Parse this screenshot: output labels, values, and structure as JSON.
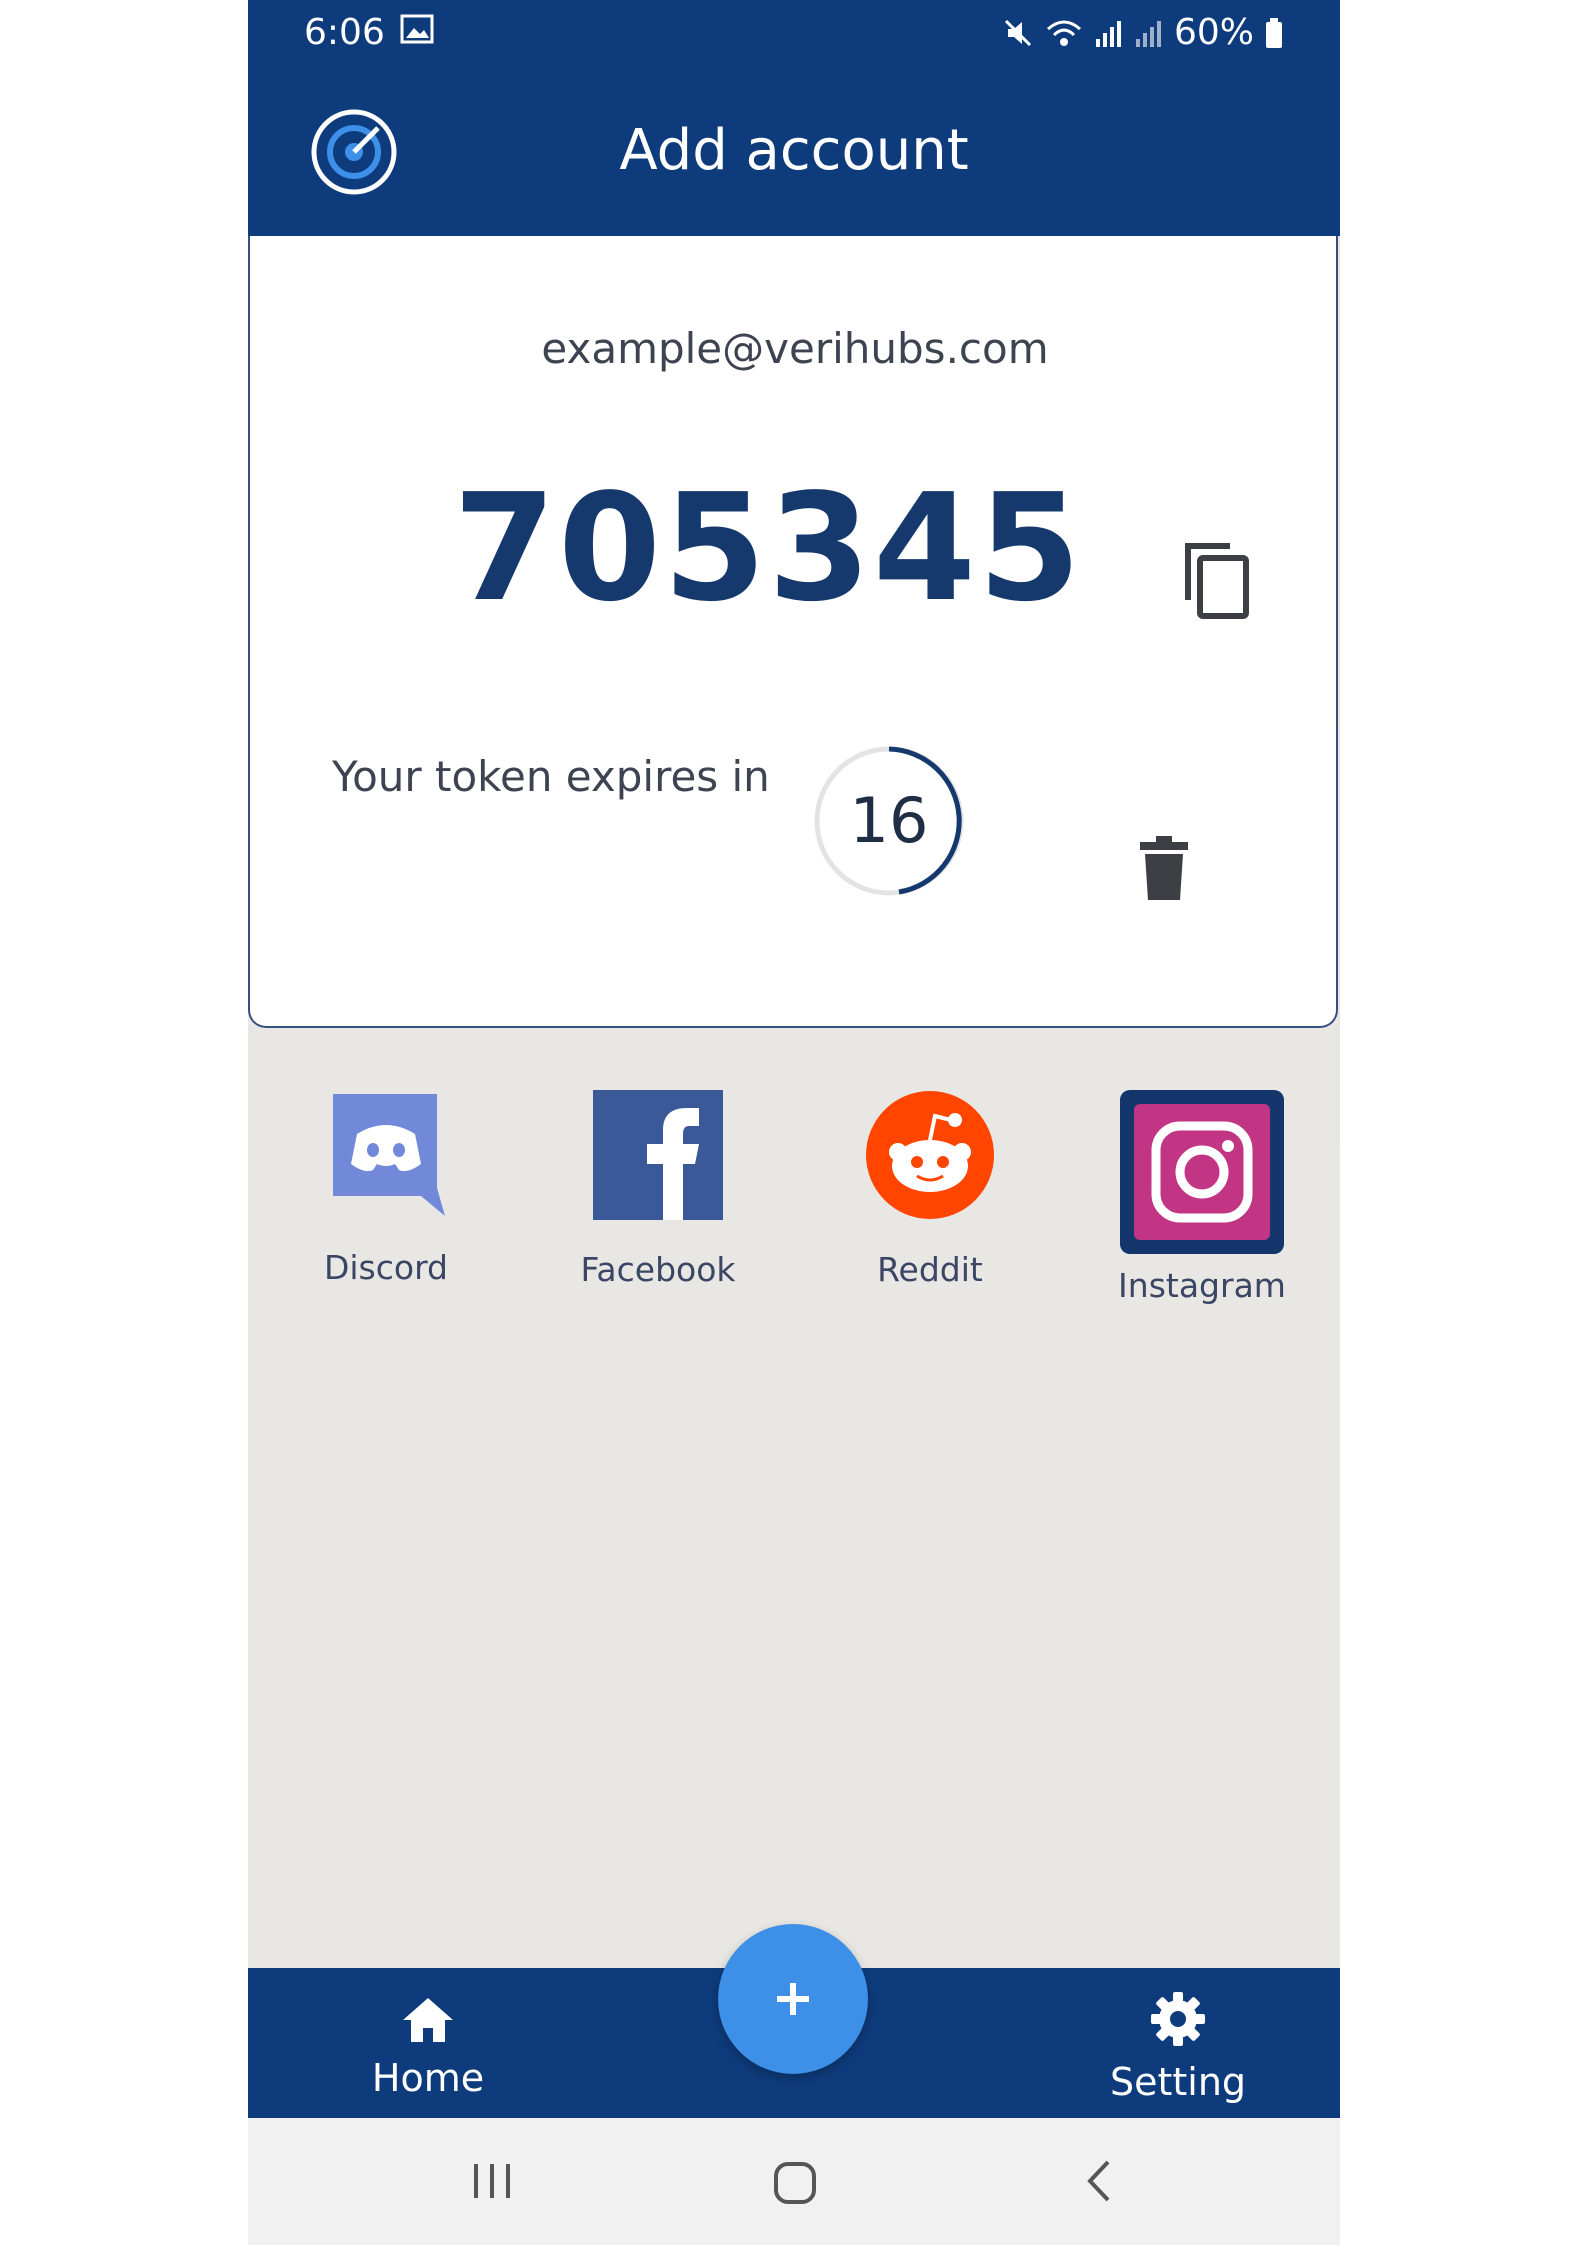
{
  "status_bar": {
    "time": "6:06",
    "battery": "60%",
    "icons": [
      "image-icon",
      "mute-icon",
      "wifi-icon",
      "signal-icon",
      "signal-icon",
      "battery-icon"
    ]
  },
  "app_bar": {
    "title": "Add account",
    "logo_icon": "app-logo-icon"
  },
  "token_card": {
    "email": "example@verihubs.com",
    "code": "705345",
    "expires_label": "Your token expires in",
    "seconds_remaining": "16",
    "copy_icon": "copy-icon",
    "delete_icon": "trash-icon"
  },
  "apps": [
    {
      "label": "Discord",
      "icon": "discord-icon",
      "color": "#7289da"
    },
    {
      "label": "Facebook",
      "icon": "facebook-icon",
      "color": "#3b5998"
    },
    {
      "label": "Reddit",
      "icon": "reddit-icon",
      "color": "#ff4500"
    },
    {
      "label": "Instagram",
      "icon": "instagram-icon",
      "color": "#c13584"
    }
  ],
  "bottom_nav": {
    "home_label": "Home",
    "setting_label": "Setting",
    "fab_icon": "plus-icon"
  },
  "colors": {
    "primary": "#0e3b7c",
    "fab": "#3d8fe8",
    "code_text": "#15386d"
  }
}
